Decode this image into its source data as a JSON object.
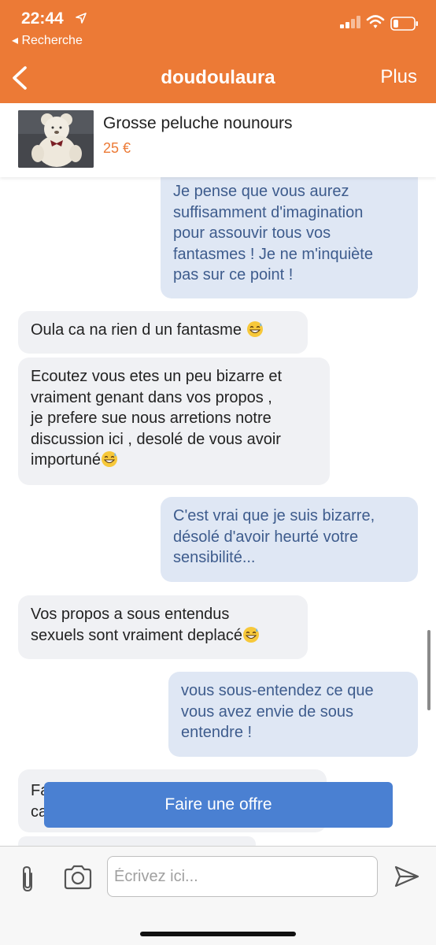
{
  "status_bar": {
    "time": "22:44",
    "back_app": "◂ Recherche"
  },
  "header": {
    "title": "doudoulaura",
    "more_label": "Plus",
    "background": "#ec7a36"
  },
  "product": {
    "name": "Grosse peluche nounours",
    "price": "25 €",
    "thumbnail_icon": "teddy-bear-image"
  },
  "messages": [
    {
      "side": "out",
      "lines": [
        "Je pense que vous aurez",
        "suffisamment d'imagination",
        "pour assouvir tous vos",
        "fantasmes ! Je ne m'inquiète",
        "pas sur ce point !"
      ]
    },
    {
      "side": "in",
      "lines": [
        "Oula ca na rien d un fantasme"
      ],
      "emoji": "grinning-sweat-emoji"
    },
    {
      "side": "in",
      "lines": [
        "Ecoutez vous etes un peu bizarre et",
        "vraiment genant dans vos propos ,",
        "je prefere sue nous arretions notre",
        "discussion ici , desolé de vous avoir",
        "importuné"
      ],
      "emoji": "grinning-sweat-emoji"
    },
    {
      "side": "out",
      "lines": [
        "C'est vrai que je suis bizarre,",
        "désolé d'avoir heurté votre",
        "sensibilité..."
      ]
    },
    {
      "side": "in",
      "lines": [
        "Vos propos a sous entendus",
        "sexuels sont vraiment deplacé"
      ],
      "emoji": "grinning-sweat-emoji"
    },
    {
      "side": "out",
      "lines": [
        "vous sous-entendez ce que",
        "vous avez envie de sous",
        "entendre !"
      ]
    },
    {
      "side": "in",
      "lines": [
        "Fa",
        "ca"
      ]
    }
  ],
  "offer_button": {
    "label": "Faire une offre",
    "color": "#4a80d2"
  },
  "composer": {
    "placeholder": "Écrivez ici...",
    "value": ""
  },
  "colors": {
    "incoming_bubble": "#f0f1f4",
    "outgoing_bubble": "#dfe7f4",
    "outgoing_text": "#3e5c8d",
    "price": "#ec7a36"
  }
}
